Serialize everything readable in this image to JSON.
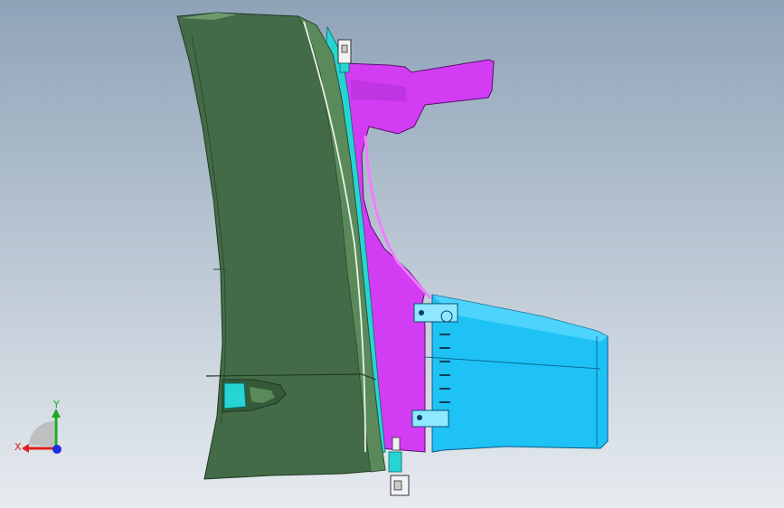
{
  "viewport": {
    "background_top": "#8fa3b8",
    "background_bottom": "#e6ebef"
  },
  "model": {
    "parts": [
      {
        "name": "fender-panel",
        "color": "#446b47"
      },
      {
        "name": "fender-flange",
        "color": "#5b8a5a"
      },
      {
        "name": "seal-strip",
        "color": "#27d4d4"
      },
      {
        "name": "inner-bracket",
        "color": "#d23cf2"
      },
      {
        "name": "air-duct",
        "color": "#1ec2f5"
      },
      {
        "name": "clip-fastener",
        "color": "#f2f2f2"
      }
    ]
  },
  "triad": {
    "x_label": "X",
    "y_label": "Y",
    "x_color": "#e02020",
    "y_color": "#1ea81e",
    "z_color": "#2030d8"
  }
}
